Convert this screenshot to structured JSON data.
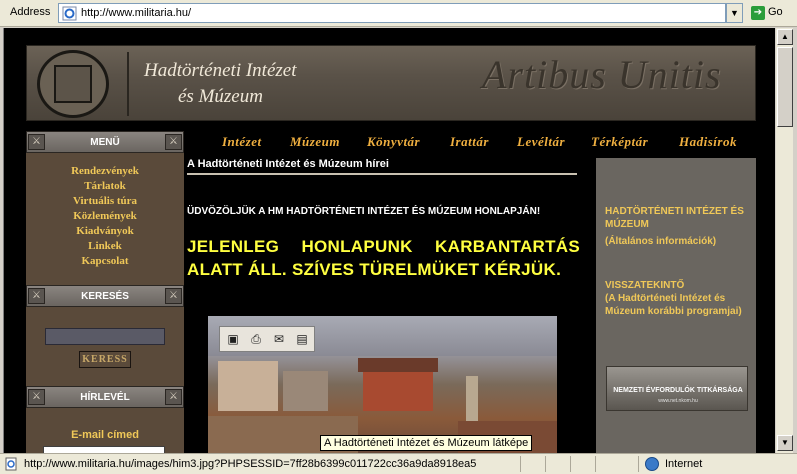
{
  "browser": {
    "address_label": "Address",
    "url": "http://www.militaria.hu/",
    "go_label": "Go",
    "status_url": "http://www.militaria.hu/images/him3.jpg?PHPSESSID=7ff28b6399c011722cc36a9da8918ea5",
    "zone": "Internet",
    "tooltip": "A Hadtörténeti Intézet és Múzeum látképe"
  },
  "banner": {
    "title_line1": "Hadtörténeti Intézet",
    "title_line2": "és Múzeum",
    "motto": "Artibus Unitis"
  },
  "left": {
    "menu_header": "MENÜ",
    "menu_items": [
      "Rendezvények",
      "Tárlatok",
      "Virtuális túra",
      "Közlemények",
      "Kiadványok",
      "Linkek",
      "Kapcsolat"
    ],
    "search_header": "KERESÉS",
    "search_button": "KERESS",
    "newsletter_header": "HÍRLEVÉL",
    "email_label": "E-mail címed"
  },
  "nav": {
    "items": [
      "Intézet",
      "Múzeum",
      "Könyvtár",
      "Irattár",
      "Levéltár",
      "Térképtár",
      "Hadisírok"
    ]
  },
  "center": {
    "news_title": "A Hadtörténeti Intézet és Múzeum hírei",
    "welcome": "ÜDVÖZÖLJÜK A HM HADTÖRTÉNETI INTÉZET ÉS MÚZEUM HONLAPJÁN!",
    "notice": "JELENLEG HONLAPUNK KARBANTARTÁS ALATT ÁLL. SZÍVES TÜRELMÜKET KÉRJÜK."
  },
  "right": {
    "link1_title": "HADTÖRTÉNETI INTÉZET ÉS MÚZEUM",
    "link1_sub": "(Általános információk)",
    "link2_title": "VISSZATEKINTŐ",
    "link2_sub": "(A Hadtörténeti Intézet és Múzeum korábbi programjai)",
    "banner_text": "NEMZETI ÉVFORDULÓK TITKÁRSÁGA",
    "banner_sub": "www.net.nkom.hu"
  },
  "colors": {
    "menu_text": "#f0c858",
    "nav_text": "#f0b040",
    "notice_text": "#ffff40"
  }
}
